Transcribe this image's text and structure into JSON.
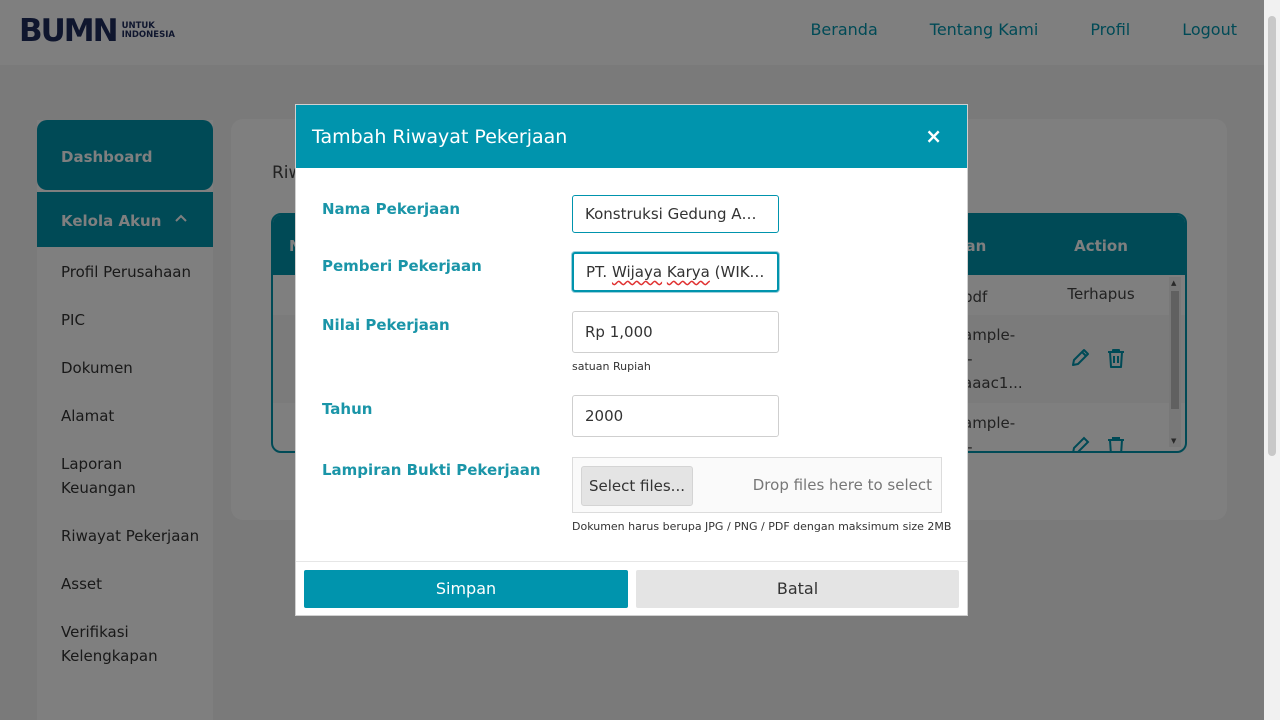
{
  "brand": {
    "logo_text": "BUMN",
    "logo_sub_1": "UNTUK",
    "logo_sub_2": "INDONESIA"
  },
  "nav": {
    "items": [
      "Beranda",
      "Tentang Kami",
      "Profil",
      "Logout"
    ]
  },
  "sidebar": {
    "dashboard": "Dashboard",
    "section": "Kelola Akun",
    "items": [
      "Profil Perusahaan",
      "PIC",
      "Dokumen",
      "Alamat",
      "Laporan Keuangan",
      "Riwayat Pekerjaan",
      "Asset",
      "Verifikasi Kelengkapan"
    ]
  },
  "content": {
    "title": "Riw",
    "table": {
      "headers": {
        "no": "N",
        "lampiran": "iran",
        "action": "Action"
      },
      "rows": [
        {
          "file": "pdf",
          "action": "Terhapus"
        },
        {
          "file_lines": [
            "ample-",
            "i-",
            "aaac1..."
          ]
        },
        {
          "file_lines": [
            "ample-",
            "i-"
          ]
        }
      ]
    }
  },
  "modal": {
    "title": "Tambah Riwayat Pekerjaan",
    "close": "×",
    "fields": {
      "nama": {
        "label": "Nama Pekerjaan",
        "value": "Konstruksi Gedung Apa..."
      },
      "pemberi": {
        "label": "Pemberi Pekerjaan",
        "value_prefix": "PT. ",
        "value_w1": "Wijaya",
        "value_space": " ",
        "value_w2": "Karya",
        "value_suffix": " (WIKA)"
      },
      "nilai": {
        "label": "Nilai Pekerjaan",
        "value": "Rp 1,000",
        "hint": "satuan Rupiah"
      },
      "tahun": {
        "label": "Tahun",
        "value": "2000"
      },
      "lampiran": {
        "label": "Lampiran Bukti Pekerjaan",
        "button": "Select files...",
        "drop": "Drop files here to select",
        "hint": "Dokumen harus berupa JPG / PNG / PDF dengan maksimum size 2MB"
      }
    },
    "buttons": {
      "save": "Simpan",
      "cancel": "Batal"
    }
  },
  "colors": {
    "primary": "#0094ad",
    "label": "#1a95a8",
    "backdrop": "rgba(0,0,0,0.5)"
  },
  "icons": {
    "edit": "pencil-icon",
    "delete": "trash-icon",
    "close": "close-icon",
    "chevron": "chevron-up-icon"
  }
}
